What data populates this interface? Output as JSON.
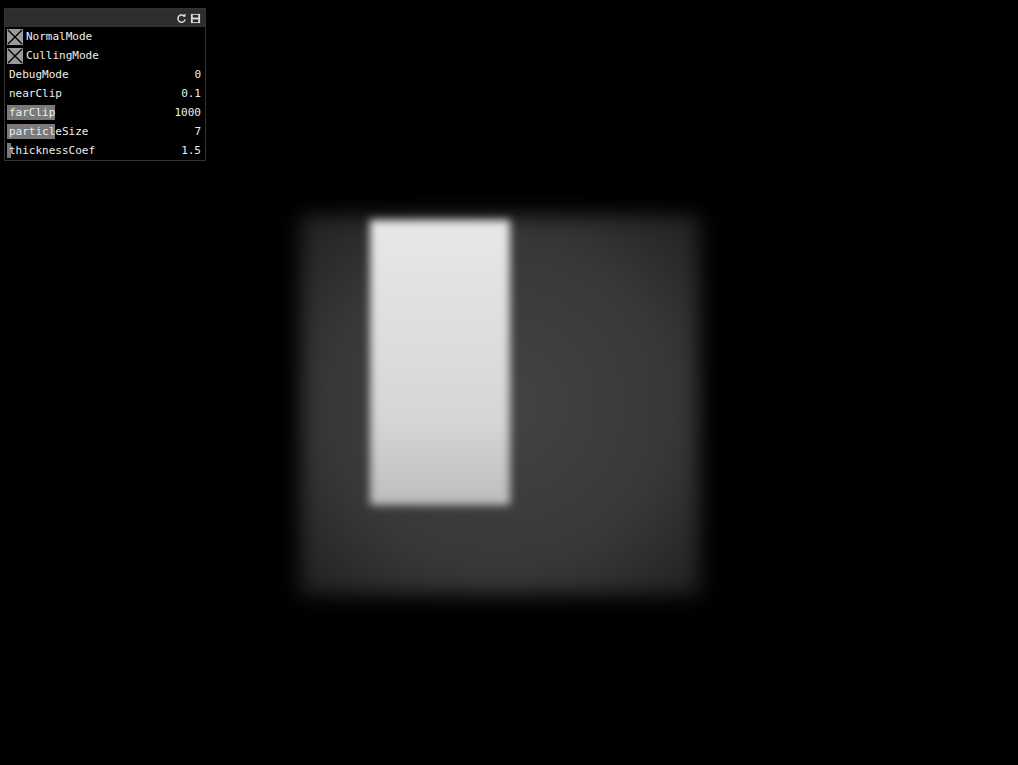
{
  "panel": {
    "rows": [
      {
        "kind": "toggle",
        "label": "NormalMode",
        "checked": true
      },
      {
        "kind": "toggle",
        "label": "CullingMode",
        "checked": true
      },
      {
        "kind": "slider",
        "label": "DebugMode",
        "value": "0",
        "level": 0
      },
      {
        "kind": "slider",
        "label": "nearClip",
        "value": "0.1",
        "level": 0
      },
      {
        "kind": "slider",
        "label": "farClip",
        "value": "1000",
        "level": 0.24
      },
      {
        "kind": "slider",
        "label": "particleSize",
        "value": "7",
        "level": 0.24
      },
      {
        "kind": "slider",
        "label": "thicknessCoef",
        "value": "1.5",
        "level": 0.02
      }
    ]
  }
}
